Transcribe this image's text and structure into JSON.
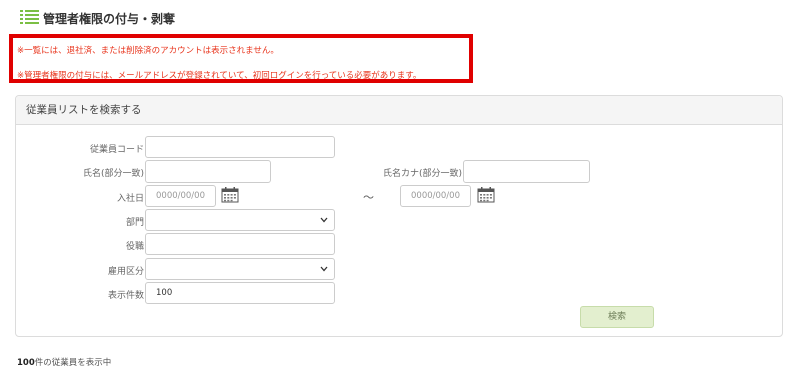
{
  "header": {
    "title": "管理者権限の付与・剥奪",
    "icon": "list-icon"
  },
  "notices": [
    "※一覧には、退社済、または削除済のアカウントは表示されません。",
    "※管理者権限の付与には、メールアドレスが登録されていて、初回ログインを行っている必要があります。"
  ],
  "panel": {
    "title": "従業員リストを検索する"
  },
  "form": {
    "employee_code": {
      "label": "従業員コード",
      "value": ""
    },
    "name": {
      "label": "氏名(部分一致)",
      "value": ""
    },
    "name_kana": {
      "label": "氏名カナ(部分一致)",
      "value": ""
    },
    "hire_date": {
      "label": "入社日",
      "from_placeholder": "0000/00/00",
      "separator": "～",
      "to_placeholder": "0000/00/00"
    },
    "department": {
      "label": "部門",
      "value": ""
    },
    "position": {
      "label": "役職",
      "value": ""
    },
    "employment_type": {
      "label": "雇用区分",
      "value": ""
    },
    "display_count": {
      "label": "表示件数",
      "value": "100"
    }
  },
  "search_button": {
    "label": "検索"
  },
  "result": {
    "count": "100",
    "suffix": "件の従業員を表示中"
  },
  "colors": {
    "notice_border": "#e00000",
    "notice_text": "#e8341c",
    "button_bg": "#e3efcf",
    "icon_green": "#7bbf44"
  }
}
